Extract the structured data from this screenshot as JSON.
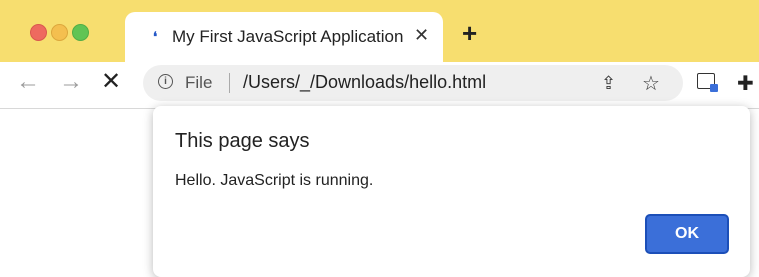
{
  "tab": {
    "favicon": "loading-icon",
    "title": "My First JavaScript Application",
    "close_glyph": "✕"
  },
  "new_tab_glyph": "+",
  "toolbar": {
    "back_glyph": "←",
    "forward_glyph": "→",
    "stop_glyph": "✕"
  },
  "omnibox": {
    "info_glyph": "i",
    "scheme_label": "File",
    "url": "/Users/_/Downloads/hello.html",
    "share_glyph": "⇪",
    "star_glyph": "☆"
  },
  "extensions": {
    "puzzle_glyph": "✚"
  },
  "dialog": {
    "title": "This page says",
    "message": "Hello. JavaScript is running.",
    "ok_label": "OK"
  },
  "colors": {
    "tabstrip": "#f7de6f",
    "ok_button": "#3b6fd9"
  }
}
